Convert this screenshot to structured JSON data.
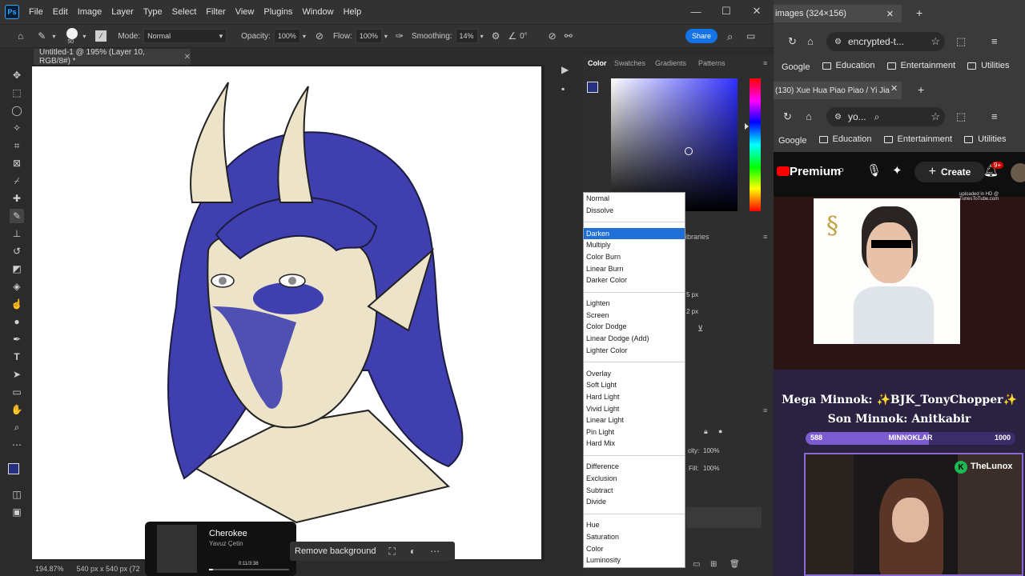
{
  "ps": {
    "menu": [
      "File",
      "Edit",
      "Image",
      "Layer",
      "Type",
      "Select",
      "Filter",
      "View",
      "Plugins",
      "Window",
      "Help"
    ],
    "brush_size": "50",
    "mode_label": "Mode:",
    "mode_value": "Normal",
    "opacity_label": "Opacity:",
    "opacity_value": "100%",
    "flow_label": "Flow:",
    "flow_value": "100%",
    "smoothing_label": "Smoothing:",
    "smoothing_value": "14%",
    "angle_value": "0°",
    "share_label": "Share",
    "doc_tab": "Untitled-1 @ 195% (Layer 10, RGB/8#) *",
    "status_zoom": "194.87%",
    "status_info": "540 px x 540 px (72",
    "remove_bg": "Remove background",
    "panel_tabs": [
      "Color",
      "Swatches",
      "Gradients",
      "Patterns"
    ],
    "libraries": "Libraries",
    "side_values": [
      "5 px",
      "2 px"
    ],
    "opacity_panel_label": "city:",
    "opacity_panel_value": "100%",
    "fill_label": "Fill:",
    "fill_value": "100%",
    "colors": {
      "foreground": "#26307e",
      "hair": "#3f3fb0",
      "skin": "#ece3c8"
    }
  },
  "blend_menu": {
    "groups": [
      [
        "Normal",
        "Dissolve"
      ],
      [
        "Darken",
        "Multiply",
        "Color Burn",
        "Linear Burn",
        "Darker Color"
      ],
      [
        "Lighten",
        "Screen",
        "Color Dodge",
        "Linear Dodge (Add)",
        "Lighter Color"
      ],
      [
        "Overlay",
        "Soft Light",
        "Hard Light",
        "Vivid Light",
        "Linear Light",
        "Pin Light",
        "Hard Mix"
      ],
      [
        "Difference",
        "Exclusion",
        "Subtract",
        "Divide"
      ],
      [
        "Hue",
        "Saturation",
        "Color",
        "Luminosity"
      ]
    ],
    "selected": "Darken"
  },
  "now_playing": {
    "title": "Cherokee",
    "artist": "Yavuz Çetin",
    "time": "0:11/3:38",
    "progress": 0.05
  },
  "browser1": {
    "tab_title": "images (324×156)",
    "address": "encrypted-t...",
    "bookmarks": [
      "Google",
      "Education",
      "Entertainment",
      "Utilities"
    ]
  },
  "browser2": {
    "tab_title": "(130) Xue Hua Piao Piao / Yi Jia",
    "address": "yo...",
    "bookmarks": [
      "Google",
      "Education",
      "Entertainment",
      "Utilities"
    ]
  },
  "youtube": {
    "brand": "Premium",
    "create_label": "Create",
    "notif_count": "9+",
    "uploaded_note": "uploaded in HD @ TunesToTube.com"
  },
  "overlay": {
    "line1": "Mega Minnok: ✨BJK_TonyChopper✨",
    "line2": "Son Minnok: Anitkabir",
    "bar_left": "588",
    "bar_label": "MINNOKLAR",
    "bar_right": "1000",
    "bar_fraction": 0.588,
    "cam_label": "TheLunox"
  }
}
